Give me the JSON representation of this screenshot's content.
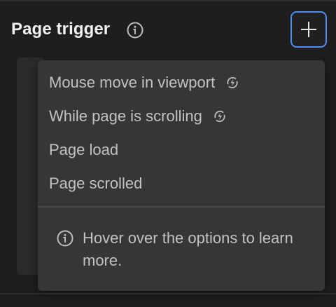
{
  "panel": {
    "title": "Page trigger",
    "info_icon": "info-icon",
    "add_button_icon": "plus-icon"
  },
  "menu": {
    "items": [
      {
        "label": "Mouse move in viewport",
        "icon": "bolt-refresh-icon"
      },
      {
        "label": "While page is scrolling",
        "icon": "bolt-refresh-icon"
      },
      {
        "label": "Page load"
      },
      {
        "label": "Page scrolled"
      }
    ],
    "hint": {
      "icon": "info-icon",
      "text": "Hover over the options to learn more."
    }
  },
  "colors": {
    "background": "#1e1e1e",
    "menu_background": "#363636",
    "accent": "#4d8ff7",
    "text": "#c2c2c2",
    "title": "#f2f2f2"
  }
}
